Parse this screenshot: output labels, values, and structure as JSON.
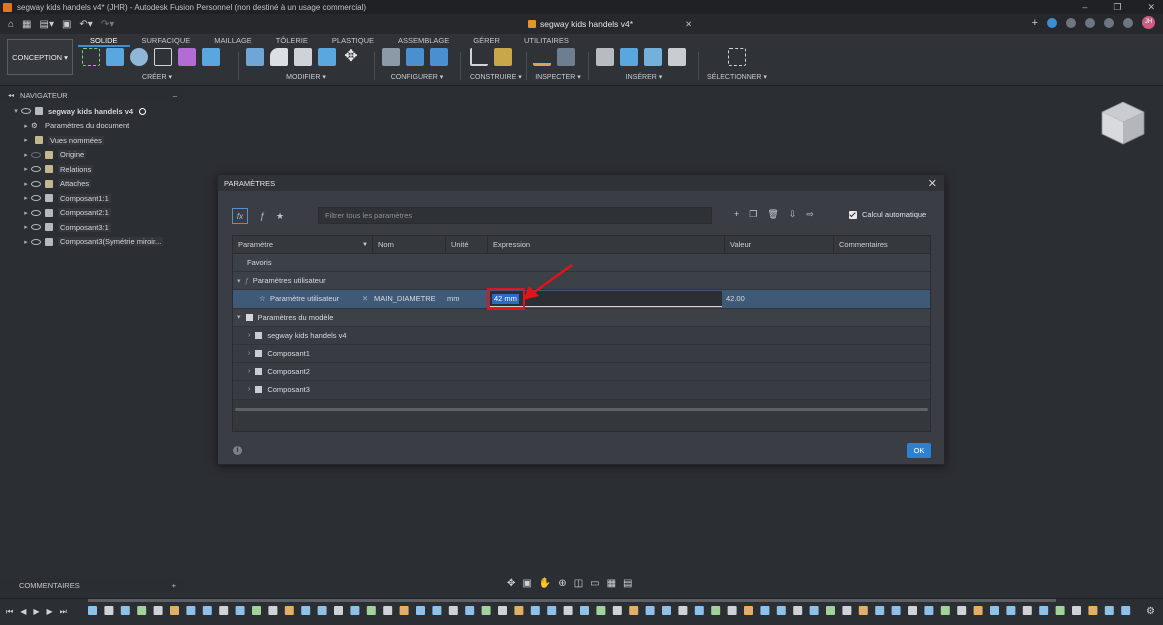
{
  "window": {
    "title": "segway kids handels v4* (JHR) - Autodesk Fusion Personnel (non destiné à un usage commercial)",
    "minimize": "–",
    "maximize": "❐",
    "close": "✕"
  },
  "tabbar": {
    "doc_tab": "segway kids handels v4*",
    "close": "✕"
  },
  "user": {
    "initials": "JH"
  },
  "ribbon": {
    "workspace": "CONCEPTION ▾",
    "tabs": [
      "SOLIDE",
      "SURFACIQUE",
      "MAILLAGE",
      "TÔLERIE",
      "PLASTIQUE",
      "ASSEMBLAGE",
      "GÉRER",
      "UTILITAIRES"
    ],
    "groups": {
      "create": "CRÉER ▾",
      "modify": "MODIFIER ▾",
      "configure": "CONFIGURER ▾",
      "construct": "CONSTRUIRE ▾",
      "inspect": "INSPECTER ▾",
      "insert": "INSÉRER ▾",
      "select": "SÉLECTIONNER ▾"
    }
  },
  "navigator": {
    "header": "NAVIGATEUR",
    "collapse": "–",
    "items": [
      "segway kids handels v4",
      "Paramètres du document",
      "Vues nommées",
      "Origine",
      "Relations",
      "Attaches",
      "Composant1:1",
      "Composant2:1",
      "Composant3:1",
      "Composant3(Symétrie miroir..."
    ]
  },
  "dialog": {
    "title": "PARAMÈTRES",
    "close": "✕",
    "filter_placeholder": "Filtrer tous les paramètres",
    "auto_calc_label": "Calcul automatique",
    "fx": "fx",
    "columns": {
      "param": "Paramètre",
      "name": "Nom",
      "unit": "Unité",
      "expression": "Expression",
      "value": "Valeur",
      "comments": "Commentaires"
    },
    "favorites": "Favoris",
    "user_params_section": "Paramètres utilisateur",
    "user_param_row": {
      "type": "Paramètre utilisateur",
      "name": "MAIN_DIAMETRE",
      "unit": "mm",
      "expression": "42 mm",
      "value": "42.00"
    },
    "model_params_section": "Paramètres du modèle",
    "model_items": [
      "segway kids handels v4",
      "Composant1",
      "Composant2",
      "Composant3"
    ],
    "ok_label": "OK",
    "info": "i"
  },
  "comments_panel": {
    "label": "COMMENTAIRES",
    "add": "+"
  }
}
